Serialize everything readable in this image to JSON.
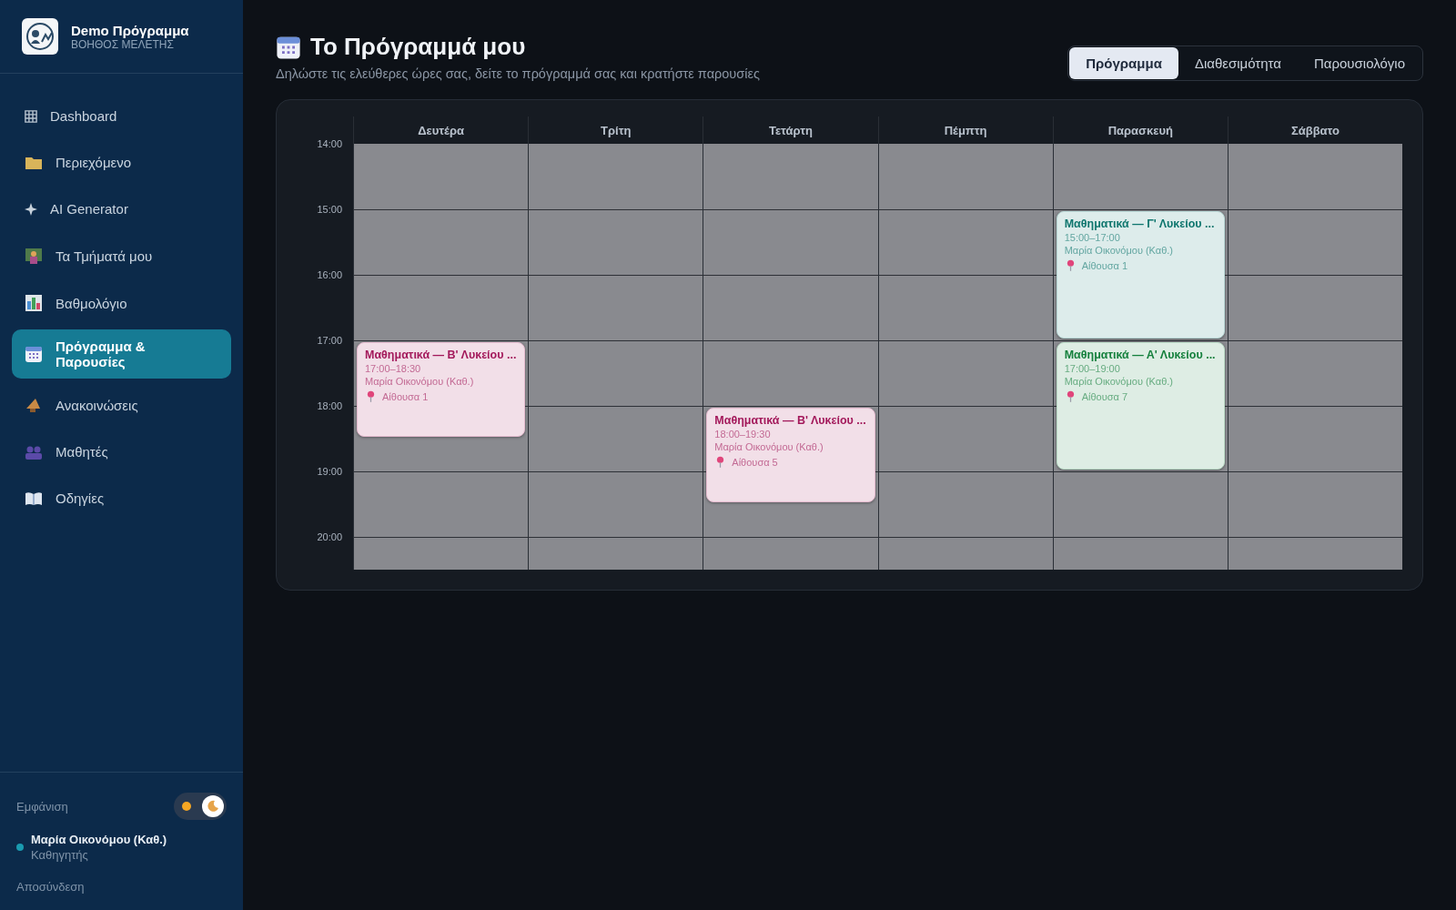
{
  "brand": {
    "title": "Demo Πρόγραμμα",
    "subtitle": "ΒΟΗΘΟΣ ΜΕΛΕΤΗΣ"
  },
  "nav": [
    {
      "label": "Dashboard",
      "kind": "grid",
      "selected": false
    },
    {
      "label": "Περιεχόμενο",
      "kind": "folder",
      "selected": false
    },
    {
      "label": "AI Generator",
      "kind": "sparkle",
      "selected": false
    },
    {
      "label": "Τα Τμήματά μου",
      "kind": "class",
      "selected": false
    },
    {
      "label": "Βαθμολόγιο",
      "kind": "chart",
      "selected": false
    },
    {
      "label": "Πρόγραμμα & Παρουσίες",
      "kind": "calendar",
      "selected": true
    },
    {
      "label": "Ανακοινώσεις",
      "kind": "megaphone",
      "selected": false
    },
    {
      "label": "Μαθητές",
      "kind": "people",
      "selected": false
    },
    {
      "label": "Οδηγίες",
      "kind": "book",
      "selected": false
    }
  ],
  "appearance": {
    "label": "Εμφάνιση",
    "dark_mode": true
  },
  "user": {
    "name": "Μαρία Οικονόμου (Καθ.)",
    "role": "Καθηγητής"
  },
  "logout": "Αποσύνδεση",
  "page": {
    "title": "Το Πρόγραμμά μου",
    "subtitle": "Δηλώστε τις ελεύθερες ώρες σας, δείτε το πρόγραμμά σας και κρατήστε παρουσίες"
  },
  "tabs": [
    {
      "label": "Πρόγραμμα",
      "selected": true
    },
    {
      "label": "Διαθεσιμότητα",
      "selected": false
    },
    {
      "label": "Παρουσιολόγιο",
      "selected": false
    }
  ],
  "hours": [
    "14:00",
    "15:00",
    "16:00",
    "17:00",
    "18:00",
    "19:00",
    "20:00"
  ],
  "days": [
    {
      "name": "Δευτέρα",
      "events": [
        {
          "title": "Μαθηματικά — Β' Λυκείου ...",
          "time": "17:00–18:30",
          "teacher": "Μαρία Οικονόμου (Καθ.)",
          "room": "Αίθουσα 1",
          "color": "#a3195b"
        }
      ]
    },
    {
      "name": "Τρίτη"
    },
    {
      "name": "Τετάρτη",
      "events": [
        {
          "title": "Μαθηματικά — Β' Λυκείου ...",
          "time": "18:00–19:30",
          "teacher": "Μαρία Οικονόμου (Καθ.)",
          "room": "Αίθουσα 5",
          "color": "#a3195b"
        }
      ]
    },
    {
      "name": "Πέμπτη"
    },
    {
      "name": "Παρασκευή",
      "events": [
        {
          "title": "Μαθηματικά — Γ' Λυκείου ...",
          "time": "15:00–17:00",
          "teacher": "Μαρία Οικονόμου (Καθ.)",
          "room": "Αίθουσα 1",
          "color": "#0f766e"
        },
        {
          "title": "Μαθηματικά — Α' Λυκείου ...",
          "time": "17:00–19:00",
          "teacher": "Μαρία Οικονόμου (Καθ.)",
          "room": "Αίθουσα 7",
          "color": "#15803d"
        }
      ]
    },
    {
      "name": "Σάββατο"
    }
  ]
}
